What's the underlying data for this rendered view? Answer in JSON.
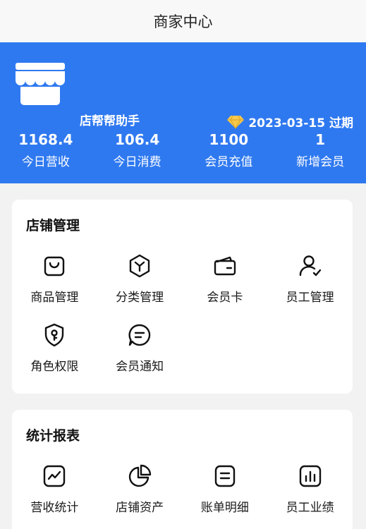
{
  "header": {
    "title": "商家中心"
  },
  "banner": {
    "shop_name": "店帮帮助手",
    "expiry": "2023-03-15 过期",
    "stats": [
      {
        "value": "1168.4",
        "label": "今日营收"
      },
      {
        "value": "106.4",
        "label": "今日消费"
      },
      {
        "value": "1100",
        "label": "会员充值"
      },
      {
        "value": "1",
        "label": "新增会员"
      }
    ],
    "colors": {
      "background": "#2f79f0",
      "diamond": "#f6c94c"
    }
  },
  "store_management": {
    "title": "店铺管理",
    "items": [
      {
        "label": "商品管理",
        "icon": "shopping-bag-icon"
      },
      {
        "label": "分类管理",
        "icon": "category-hexagon-icon"
      },
      {
        "label": "会员卡",
        "icon": "card-icon"
      },
      {
        "label": "员工管理",
        "icon": "user-check-icon"
      },
      {
        "label": "角色权限",
        "icon": "shield-key-icon"
      },
      {
        "label": "会员通知",
        "icon": "message-bubble-icon"
      }
    ]
  },
  "reports": {
    "title": "统计报表",
    "items": [
      {
        "label": "营收统计",
        "icon": "trend-chart-icon"
      },
      {
        "label": "店铺资产",
        "icon": "pie-chart-icon"
      },
      {
        "label": "账单明细",
        "icon": "bill-list-icon"
      },
      {
        "label": "员工业绩",
        "icon": "bar-chart-icon"
      }
    ]
  }
}
